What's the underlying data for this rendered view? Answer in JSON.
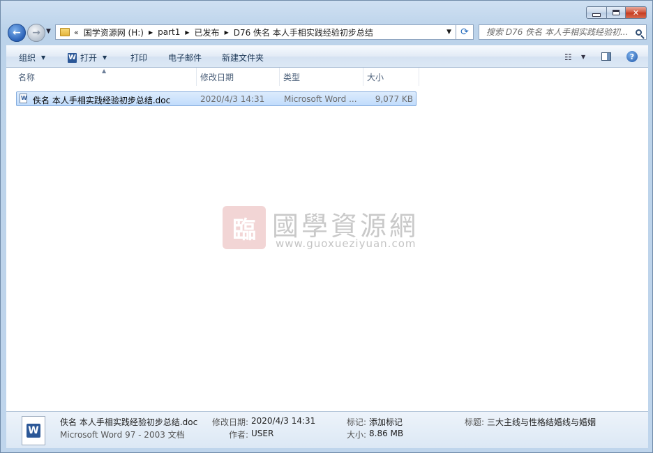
{
  "nav": {
    "crumbs": [
      "国学资源网 (H:)",
      "part1",
      "已发布",
      "D76 佚名 本人手相实践经验初步总结"
    ],
    "search_placeholder": "搜索 D76 佚名 本人手相实践经验初..."
  },
  "toolbar": {
    "organize": "组织",
    "open": "打开",
    "print": "打印",
    "email": "电子邮件",
    "new_folder": "新建文件夹"
  },
  "columns": {
    "name": "名称",
    "date": "修改日期",
    "type": "类型",
    "size": "大小"
  },
  "file": {
    "name": "佚名 本人手相实践经验初步总结.doc",
    "date": "2020/4/3 14:31",
    "type": "Microsoft Word ...",
    "size": "9,077 KB"
  },
  "watermark": {
    "title": "國學資源網",
    "url": "www.guoxueziyuan.com",
    "logo_char": "臨"
  },
  "details": {
    "filename": "佚名 本人手相实践经验初步总结.doc",
    "filetype": "Microsoft Word 97 - 2003 文档",
    "date_label": "修改日期:",
    "date_value": "2020/4/3 14:31",
    "author_label": "作者:",
    "author_value": "USER",
    "tags_label": "标记:",
    "tags_value": "添加标记",
    "size_label": "大小:",
    "size_value": "8.86 MB",
    "title_label": "标题:",
    "title_value": "三大主线与性格结婚线与婚姻"
  },
  "colors": {
    "selection": "#c1dcfc",
    "window_frame": "#bcd3ea"
  }
}
